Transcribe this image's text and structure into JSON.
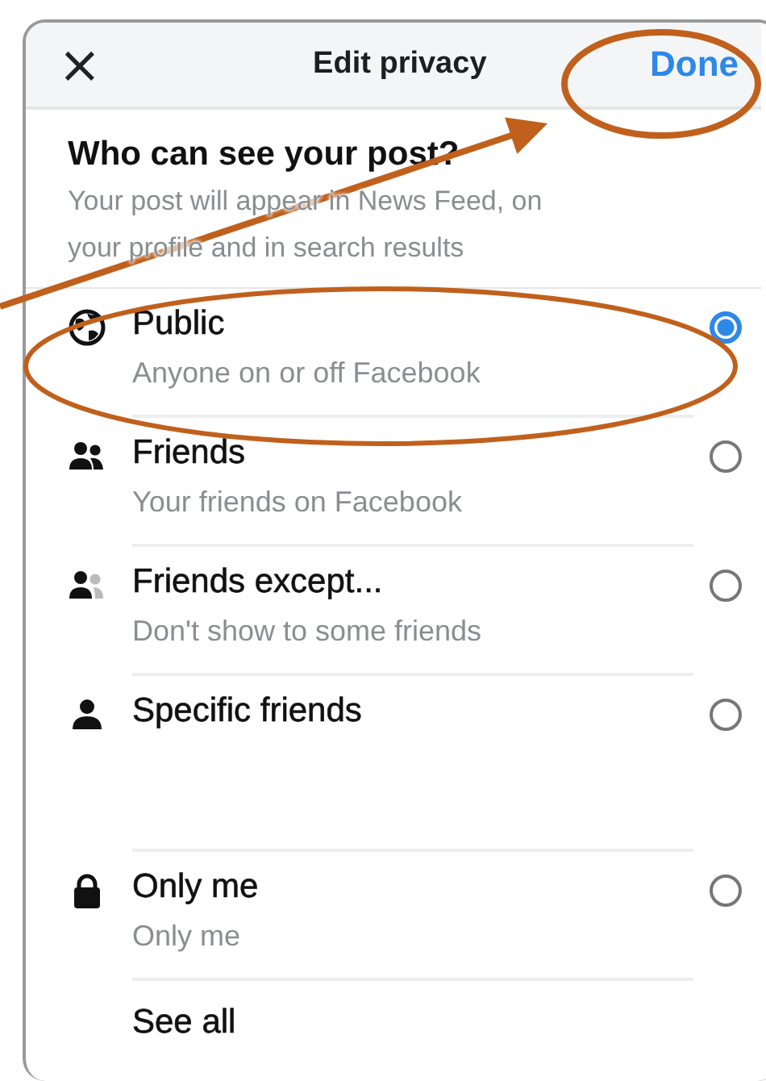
{
  "header": {
    "close": "×",
    "title": "Edit privacy",
    "done": "Done"
  },
  "intro": {
    "heading": "Who can see your post?",
    "text": "Your post will appear in News Feed, on your profile and in search results"
  },
  "options": [
    {
      "kind": "globe",
      "title": "Public",
      "subtitle": "Anyone on or off Facebook",
      "selected": true
    },
    {
      "kind": "friends",
      "title": "Friends",
      "subtitle": "Your friends on Facebook",
      "selected": false
    },
    {
      "kind": "friends-except",
      "title": "Friends except...",
      "subtitle": "Don't show to some friends",
      "selected": false
    },
    {
      "kind": "person",
      "title": "Specific friends",
      "selected": false
    },
    {
      "kind": "lock",
      "title": "Only me",
      "subtitle": "Only me",
      "selected": false
    }
  ],
  "see_all": "See all"
}
